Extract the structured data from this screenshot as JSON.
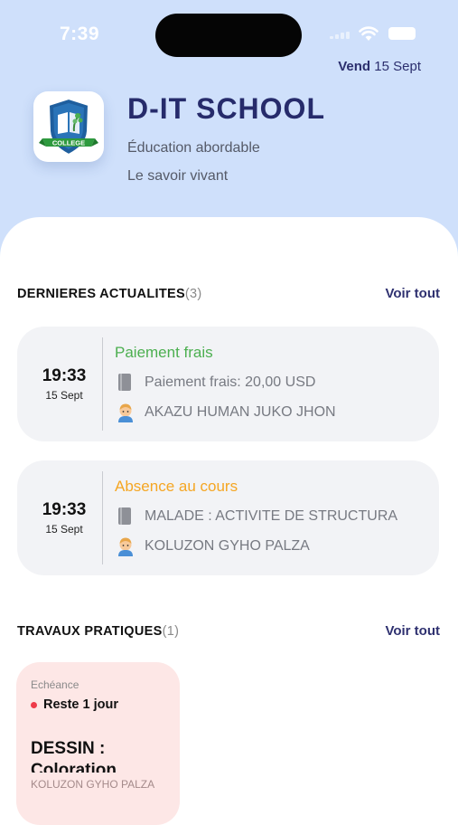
{
  "status_bar": {
    "time": "7:39"
  },
  "header": {
    "day": "Vend",
    "date": "15 Sept",
    "logo_text": "COLLEGE",
    "school_name": "D-IT SCHOOL",
    "tagline_1": "Éducation abordable",
    "tagline_2": "Le savoir vivant"
  },
  "news_section": {
    "title": "DERNIERES ACTUALITES",
    "count": "(3)",
    "see_all": "Voir tout",
    "items": [
      {
        "time": "19:33",
        "date": "15 Sept",
        "title": "Paiement frais",
        "title_color": "#4caf50",
        "detail": "Paiement frais: 20,00 USD",
        "person": "AKAZU HUMAN JUKO JHON"
      },
      {
        "time": "19:33",
        "date": "15 Sept",
        "title": "Absence au cours",
        "title_color": "#f5a623",
        "detail": "MALADE : ACTIVITE DE STRUCTURA",
        "person": "KOLUZON GYHO PALZA"
      }
    ]
  },
  "practical_section": {
    "title": "TRAVAUX PRATIQUES",
    "count": "(1)",
    "see_all": "Voir tout",
    "card": {
      "label": "Echéance",
      "remaining": "Reste 1 jour",
      "title": "DESSIN : Coloration",
      "owner": "KOLUZON GYHO PALZA"
    }
  },
  "icons": {
    "document": "document-icon",
    "student": "student-avatar-icon",
    "logo": "college-shield-logo"
  }
}
